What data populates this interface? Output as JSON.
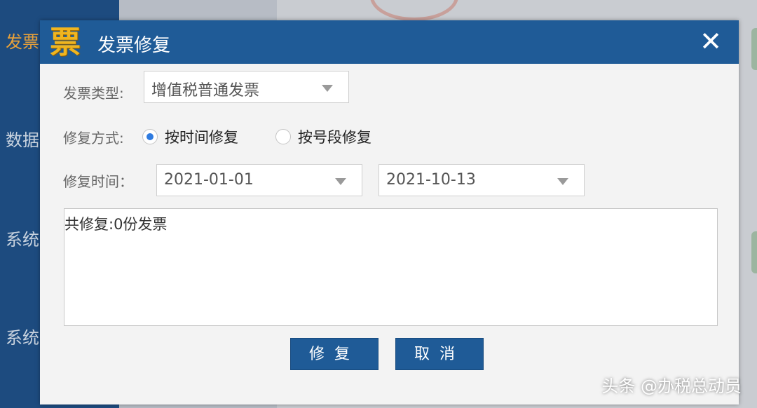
{
  "background": {
    "sidebar_items": [
      "发票",
      "数据",
      "系统",
      "系统"
    ]
  },
  "dialog": {
    "logo_char": "票",
    "title": "发票修复",
    "close_symbol": "✕",
    "invoice_type": {
      "label": "发票类型:",
      "selected": "增值税普通发票"
    },
    "repair_method": {
      "label": "修复方式:",
      "options": [
        {
          "label": "按时间修复",
          "checked": true
        },
        {
          "label": "按号段修复",
          "checked": false
        }
      ]
    },
    "repair_time": {
      "label": "修复时间：",
      "start": "2021-01-01",
      "end": "2021-10-13"
    },
    "result_text": "共修复:0份发票",
    "buttons": {
      "repair": "修复",
      "cancel": "取消"
    }
  },
  "watermark": "头条 @办税总动员",
  "colors": {
    "titlebar": "#1f5b97",
    "button": "#1f5b97",
    "radio_selected": "#2f7be0",
    "logo": "#f0b51f"
  }
}
